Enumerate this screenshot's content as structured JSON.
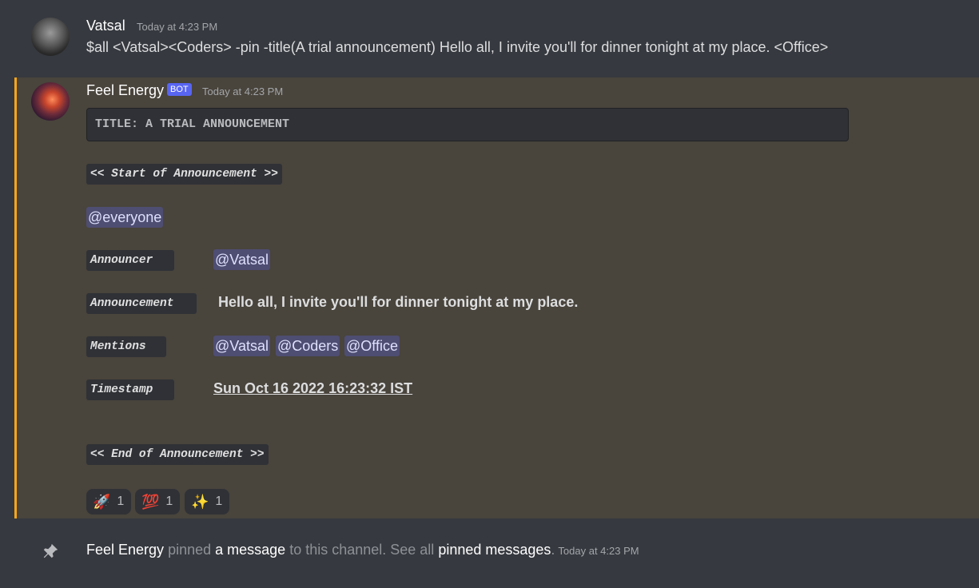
{
  "message1": {
    "username": "Vatsal",
    "timestamp": "Today at 4:23 PM",
    "text": "$all <Vatsal><Coders> -pin -title(A trial announcement) Hello all, I invite you'll for dinner tonight at my place. <Office>"
  },
  "message2": {
    "username": "Feel Energy",
    "bot_tag": "BOT",
    "timestamp": "Today at 4:23 PM",
    "title_block": "TITLE: A TRIAL ANNOUNCEMENT",
    "start_marker": "<< Start of Announcement >>",
    "everyone_mention": "@everyone",
    "announcer_label": "Announcer",
    "announcer_value": "@Vatsal",
    "announcement_label": "Announcement",
    "announcement_value": "Hello all, I invite you'll for dinner tonight at my place.",
    "mentions_label": "Mentions",
    "mentions": [
      "@Vatsal",
      "@Coders",
      "@Office"
    ],
    "timestamp_label": "Timestamp",
    "timestamp_value": "Sun Oct 16 2022 16:23:32 IST",
    "end_marker": "<< End of Announcement >>",
    "reactions": [
      {
        "emoji": "🚀",
        "count": "1"
      },
      {
        "emoji": "💯",
        "count": "1"
      },
      {
        "emoji": "✨",
        "count": "1"
      }
    ]
  },
  "system_message": {
    "actor": "Feel Energy",
    "verb": " pinned ",
    "link1": "a message",
    "middle": " to this channel. See all ",
    "link2": "pinned messages",
    "end": ".",
    "timestamp": "Today at 4:23 PM"
  },
  "colors": {
    "background": "#36393f",
    "highlight_background": "#49443c",
    "highlight_border": "#faa81a",
    "bot_tag": "#5865f2",
    "mention_bg": "#5865f2"
  }
}
